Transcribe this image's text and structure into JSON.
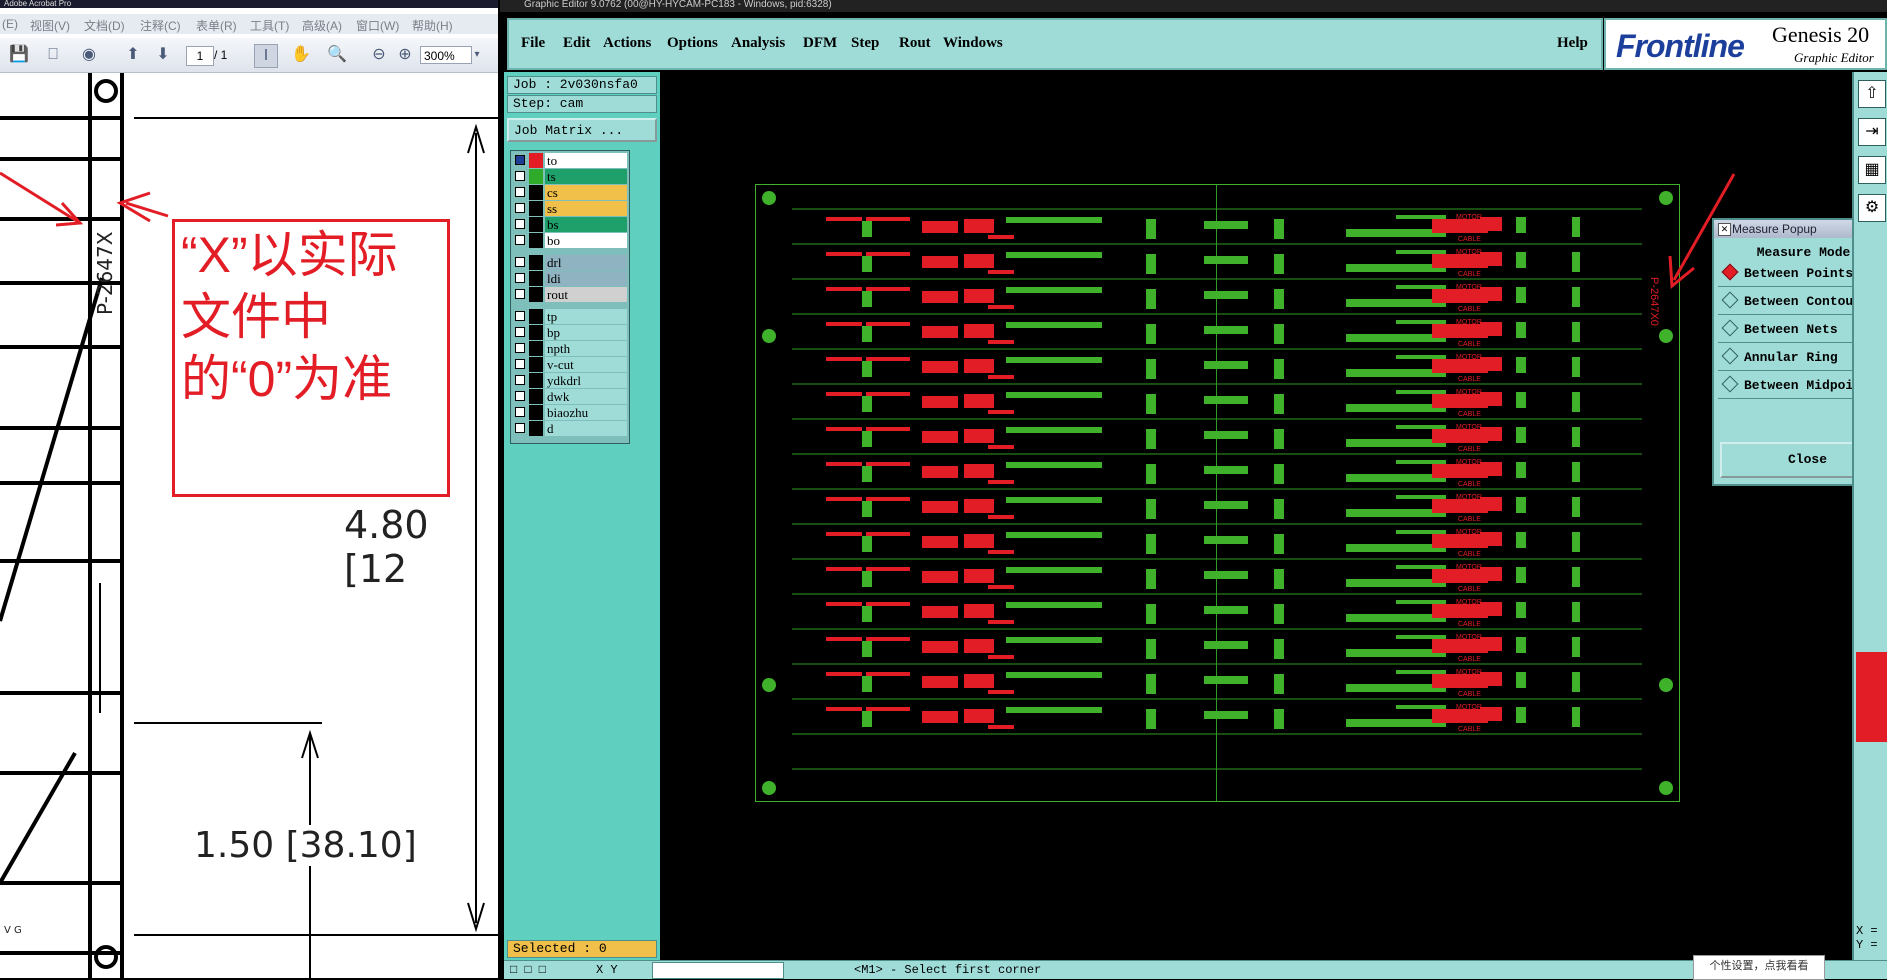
{
  "acrobat": {
    "title": "Adobe Acrobat Pro",
    "menu": [
      "(E)",
      "视图(V)",
      "文档(D)",
      "注释(C)",
      "表单(R)",
      "工具(T)",
      "高级(A)",
      "窗口(W)",
      "帮助(H)"
    ],
    "toolbar": {
      "page_current": "1",
      "page_total": "/ 1",
      "zoom": "300%"
    },
    "callout_lines": [
      "“X”以实际",
      "文件中",
      "的“0”为准"
    ],
    "part_number": "P-2647X",
    "dim_main": "4.80 [12",
    "dim_secondary": "1.50 [38.10]",
    "small_text": "V G"
  },
  "genesis": {
    "title": "Graphic Editor 9.0762 (00@HY-HYCAM-PC183 - Windows, pid:6328)",
    "menu": [
      "File",
      "Edit",
      "Actions",
      "Options",
      "Analysis",
      "DFM",
      "Step",
      "Rout",
      "Windows"
    ],
    "help": "Help",
    "brand": {
      "logo": "Frontline",
      "product": "Genesis 20",
      "subtitle": "Graphic Editor"
    },
    "job_label": "Job : 2v030nsfa0",
    "step_label": "Step: cam",
    "job_matrix_button": "Job Matrix ...",
    "layers": [
      {
        "name": "to",
        "color": "#ffffff",
        "swatch": "#e21d25",
        "on": true
      },
      {
        "name": "ts",
        "color": "#1f9f6a",
        "swatch": "#2faa2a",
        "on": false
      },
      {
        "name": "cs",
        "color": "#f1c04a",
        "swatch": "#000000",
        "on": false
      },
      {
        "name": "ss",
        "color": "#f1c04a",
        "swatch": "#000000",
        "on": false
      },
      {
        "name": "bs",
        "color": "#1f9f6a",
        "swatch": "#000000",
        "on": false
      },
      {
        "name": "bo",
        "color": "#ffffff",
        "swatch": "#000000",
        "on": false
      },
      {
        "name": "drl",
        "color": "#8fb3c0",
        "swatch": "#000000",
        "on": false
      },
      {
        "name": "ldi",
        "color": "#8fb3c0",
        "swatch": "#000000",
        "on": false
      },
      {
        "name": "rout",
        "color": "#d0d0d0",
        "swatch": "#000000",
        "on": false
      },
      {
        "name": "tp",
        "color": "#9fdcd8",
        "swatch": "#000000",
        "on": false
      },
      {
        "name": "bp",
        "color": "#9fdcd8",
        "swatch": "#000000",
        "on": false
      },
      {
        "name": "npth",
        "color": "#9fdcd8",
        "swatch": "#000000",
        "on": false
      },
      {
        "name": "v-cut",
        "color": "#9fdcd8",
        "swatch": "#000000",
        "on": false
      },
      {
        "name": "ydkdrl",
        "color": "#9fdcd8",
        "swatch": "#000000",
        "on": false
      },
      {
        "name": "dwk",
        "color": "#9fdcd8",
        "swatch": "#000000",
        "on": false
      },
      {
        "name": "biaozhu",
        "color": "#9fdcd8",
        "swatch": "#000000",
        "on": false
      },
      {
        "name": "d",
        "color": "#9fdcd8",
        "swatch": "#000000",
        "on": false
      }
    ],
    "selected_label": "Selected : 0",
    "status_prompt": "<M1> - Select first corner",
    "status_xy": "X Y",
    "coord_x": "X =",
    "coord_y": "Y =",
    "board_text": {
      "motor": "MOTOR",
      "cable": "CABLE",
      "part": "P-2647X0"
    },
    "measure_popup": {
      "title": "Measure Popup",
      "mode_label": "Measure Mode",
      "options": [
        "Between Points",
        "Between Contours",
        "Between Nets",
        "Annular Ring",
        "Between Midpoints"
      ],
      "selected_index": 0,
      "close": "Close"
    },
    "tooltip": "个性设置，点我看看"
  }
}
